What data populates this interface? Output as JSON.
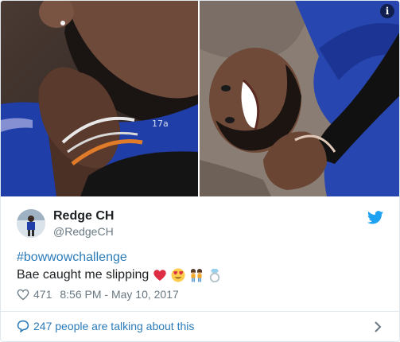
{
  "media": {
    "info_glyph": "i"
  },
  "author": {
    "name": "Redge CH",
    "handle": "@RedgeCH"
  },
  "tweet": {
    "hashtag": "#bowwowchallenge",
    "text": "Bae caught me slipping",
    "emojis": [
      "red-heart-icon",
      "heart-eyes-emoji-icon",
      "two-women-emoji-icon",
      "ring-icon"
    ]
  },
  "stats": {
    "likes": "471",
    "timestamp": "8:56 PM - May 10, 2017"
  },
  "footer": {
    "conversation_text": "247 people are talking about this"
  },
  "colors": {
    "link": "#2b7bb9",
    "twitter_blue": "#1da1f2",
    "muted": "#697882",
    "border": "#e1e8ed"
  }
}
